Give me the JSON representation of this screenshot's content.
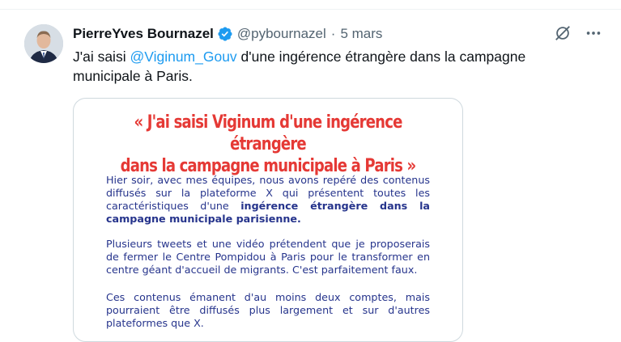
{
  "tweet": {
    "author_name": "PierreYves Bournazel",
    "handle": "@pybournazel",
    "separator": "·",
    "date": "5 mars",
    "text_before": "J'ai saisi ",
    "mention": "@Viginum_Gouv",
    "text_after": " d'une ingérence étrangère dans la campagne municipale à Paris.",
    "icons": {
      "verified": "verified-badge-icon",
      "grok": "grok-icon",
      "more": "more-icon"
    },
    "colors": {
      "link": "#1d9bf0",
      "verified": "#1d9bf0",
      "secondary_text": "#536471"
    }
  },
  "card": {
    "quote_line1": "« J'ai saisi Viginum d'une ingérence étrangère",
    "quote_line2": "dans la campagne municipale à Paris »",
    "p1_text": "Hier soir, avec mes équipes, nous avons repéré des contenus diffusés sur la plateforme X qui présentent toutes les caractéristiques d'une ",
    "p1_bold": "ingérence étrangère dans la campagne municipale parisienne.",
    "p2_text": "Plusieurs tweets et une vidéo prétendent que je proposerais de fermer le Centre Pompidou à Paris pour le transformer en centre géant d'accueil de migrants. C'est parfaitement faux.",
    "p3_text": "Ces contenus émanent d'au moins deux comptes, mais pourraient être diffusés plus largement et sur d'autres plateformes que X.",
    "colors": {
      "quote": "#e53935",
      "body": "#26348c"
    }
  }
}
